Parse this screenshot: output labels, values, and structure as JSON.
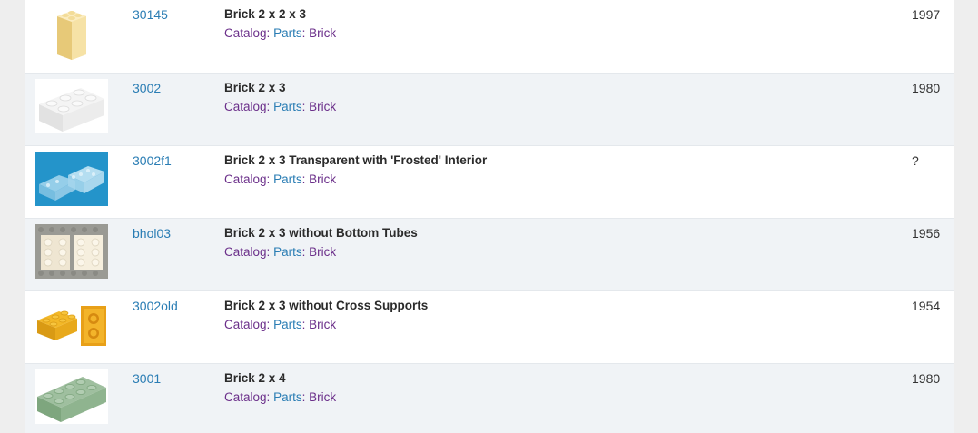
{
  "rows": [
    {
      "part": "30145",
      "title": "Brick 2 x 2 x 3",
      "catalog_label": "Catalog",
      "parts_label": "Parts",
      "brick_label": "Brick",
      "year": "1997",
      "image_icon": "tan-brick-2x2x3-icon"
    },
    {
      "part": "3002",
      "title": "Brick 2 x 3",
      "catalog_label": "Catalog",
      "parts_label": "Parts",
      "brick_label": "Brick",
      "year": "1980",
      "image_icon": "white-brick-2x3-icon"
    },
    {
      "part": "3002f1",
      "title": "Brick 2 x 3 Transparent with 'Frosted' Interior",
      "catalog_label": "Catalog",
      "parts_label": "Parts",
      "brick_label": "Brick",
      "year": "?",
      "image_icon": "transparent-brick-icon"
    },
    {
      "part": "bhol03",
      "title": "Brick 2 x 3 without Bottom Tubes",
      "catalog_label": "Catalog",
      "parts_label": "Parts",
      "brick_label": "Brick",
      "year": "1956",
      "image_icon": "cream-brick-photo-icon"
    },
    {
      "part": "3002old",
      "title": "Brick 2 x 3 without Cross Supports",
      "catalog_label": "Catalog",
      "parts_label": "Parts",
      "brick_label": "Brick",
      "year": "1954",
      "image_icon": "yellow-brick-icon"
    },
    {
      "part": "3001",
      "title": "Brick 2 x 4",
      "catalog_label": "Catalog",
      "parts_label": "Parts",
      "brick_label": "Brick",
      "year": "1980",
      "image_icon": "sand-green-brick-2x4-icon"
    }
  ],
  "colors": {
    "link": "#2a7db4",
    "catalog": "#6b2f8a",
    "row_alt": "#f0f3f6"
  }
}
